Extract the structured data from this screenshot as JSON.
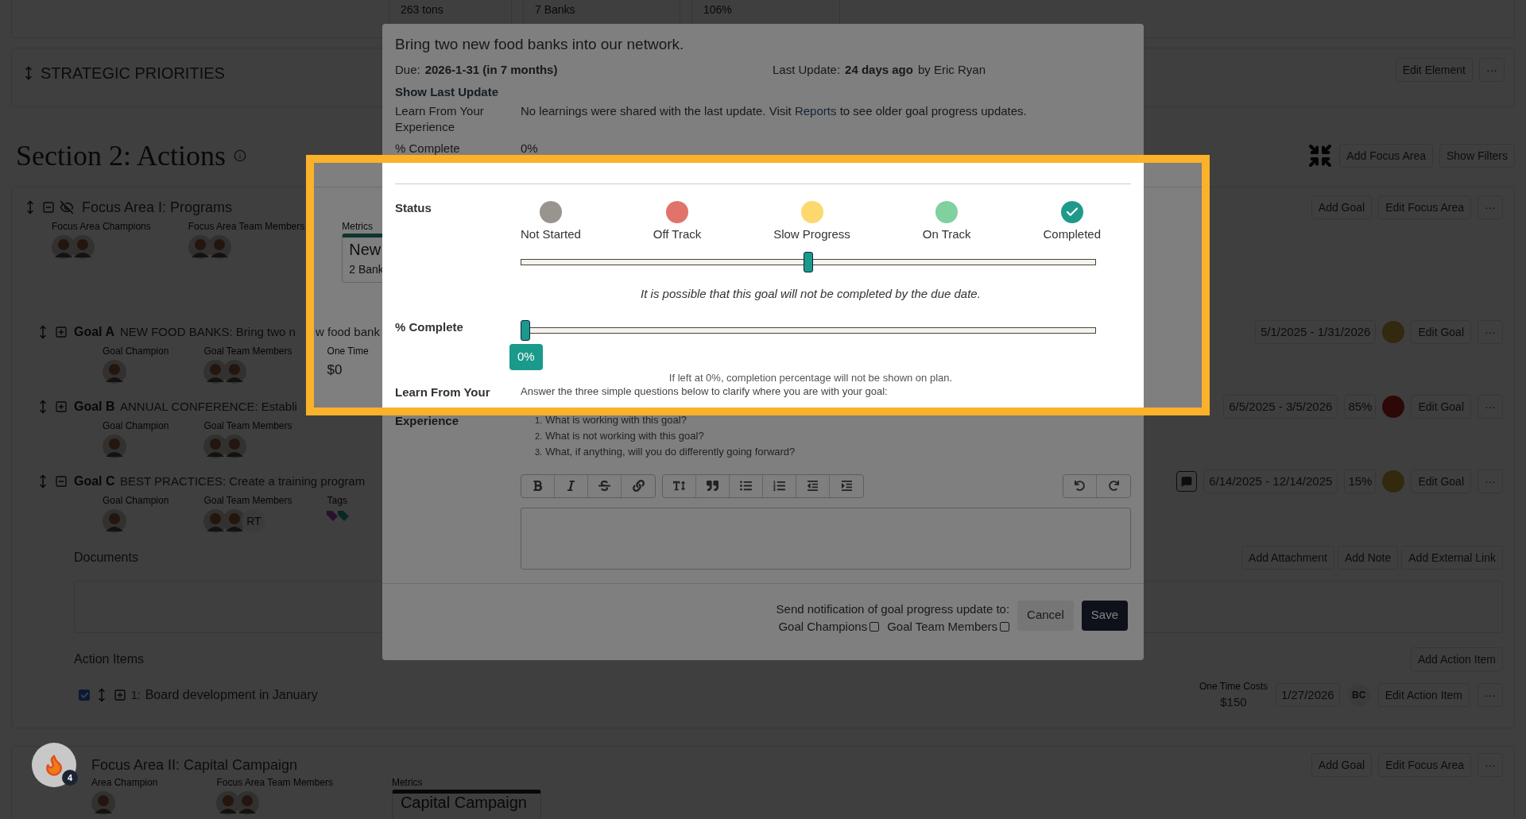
{
  "top_metrics": [
    {
      "value": "263 tons"
    },
    {
      "value": "7 Banks"
    },
    {
      "value": "106%"
    }
  ],
  "strategic_priorities": {
    "title": "STRATEGIC PRIORITIES",
    "buttons": [
      "Edit Element",
      "···"
    ]
  },
  "section": {
    "title": "Section 2: Actions",
    "buttons": [
      "Add Focus Area",
      "Show Filters"
    ]
  },
  "focus_areas": [
    {
      "title": "Focus Area I: Programs",
      "expanded": true,
      "buttons": [
        "Add Goal",
        "Edit Focus Area",
        "···"
      ],
      "people": [
        {
          "label": "Focus Area Champions",
          "avatars": [
            {
              "kind": "picture"
            },
            {
              "kind": "picture"
            }
          ]
        },
        {
          "label": "Focus Area Team Members",
          "avatars": [
            {
              "kind": "picture"
            },
            {
              "kind": "picture"
            }
          ]
        }
      ],
      "metrics": {
        "label": "Metrics",
        "card_title": "New",
        "card_value": "2 Bank",
        "kind": "teal"
      },
      "goals": [
        {
          "label": "Goal A",
          "title": "NEW FOOD BANKS: Bring two n",
          "title_rest": "w food bank",
          "expanded": false,
          "comment": false,
          "dates": "5/1/2025 - 1/31/2026",
          "status_dot": {
            "kind": "slow_progress"
          },
          "buttons": [
            "Edit Goal",
            "···"
          ],
          "fields": [
            {
              "label": "Goal Champion",
              "avatars": [
                {
                  "kind": "picture"
                }
              ]
            },
            {
              "label": "Goal Team Members",
              "avatars": [
                {
                  "kind": "picture"
                },
                {
                  "kind": "picture"
                }
              ]
            },
            {
              "label": "One Time",
              "value": "$0"
            }
          ]
        },
        {
          "label": "Goal B",
          "title": "ANNUAL CONFERENCE: Establi",
          "expanded": false,
          "comment": false,
          "dates": "6/5/2025 - 3/5/2026",
          "percent": "85%",
          "status_dot": {
            "kind": "off_track"
          },
          "buttons": [
            "Edit Goal",
            "···"
          ],
          "fields": [
            {
              "label": "Goal Champion",
              "avatars": [
                {
                  "kind": "picture"
                }
              ]
            },
            {
              "label": "Goal Team Members",
              "avatars": [
                {
                  "kind": "picture"
                },
                {
                  "kind": "picture"
                }
              ]
            }
          ]
        },
        {
          "label": "Goal C",
          "title": "BEST PRACTICES: Create a training program",
          "expanded": true,
          "comment": true,
          "dates": "6/14/2025 - 12/14/2025",
          "percent": "15%",
          "status_dot": {
            "kind": "slow_progress"
          },
          "buttons": [
            "Edit Goal",
            "···"
          ],
          "fields": [
            {
              "label": "Goal Champion",
              "avatars": [
                {
                  "kind": "picture"
                }
              ]
            },
            {
              "label": "Goal Team Members",
              "avatars": [
                {
                  "kind": "picture"
                },
                {
                  "kind": "picture"
                },
                {
                  "kind": "initials",
                  "text": "RT"
                }
              ]
            },
            {
              "label": "Tags",
              "tags": [
                {
                  "kind": "violet"
                },
                {
                  "kind": "teal"
                }
              ]
            }
          ]
        }
      ],
      "documents": {
        "title": "Documents",
        "buttons": [
          "Add Attachment",
          "Add Note",
          "Add External Link"
        ]
      },
      "action_items": {
        "title": "Action Items",
        "button": "Add Action Item",
        "items": [
          {
            "checked": true,
            "number": "1:",
            "title": "Board development in January",
            "cost_label": "One Time Costs",
            "cost": "$150",
            "date": "1/27/2026",
            "assignee": "BC",
            "buttons": [
              "Edit Action Item",
              "···"
            ]
          }
        ]
      }
    },
    {
      "title": "Focus Area II: Capital Campaign",
      "buttons": [
        "Add Goal",
        "Edit Focus Area",
        "···"
      ],
      "people": [
        {
          "label": "Area Champion",
          "avatars": [
            {
              "kind": "picture"
            }
          ]
        },
        {
          "label": "Focus Area Team Members",
          "avatars": [
            {
              "kind": "picture"
            },
            {
              "kind": "picture"
            }
          ]
        }
      ],
      "metrics": {
        "label": "Metrics",
        "card_title": "Capital Campaign",
        "kind": "dark"
      }
    }
  ],
  "floating_button": {
    "badge": "4"
  },
  "modal": {
    "title": "Bring two new food banks into our network.",
    "due_label": "Due:",
    "due": "2026-1-31 (in 7 months)",
    "last_update_label": "Last Update:",
    "last_update": "24 days ago",
    "last_update_by": "by Eric Ryan",
    "show_last_update": "Show Last Update",
    "last_learn_label": "Learn From Your Experience",
    "last_learn_before": "No learnings were shared with the last update. Visit",
    "last_learn_link": "Reports",
    "last_learn_after": "to see older goal progress updates.",
    "last_complete_label": "% Complete",
    "last_complete": "0%",
    "status": {
      "label": "Status",
      "level": 0.5,
      "note": "It is possible that this goal will not be completed by the due date.",
      "options": [
        {
          "label": "Not Started",
          "kind": "dot",
          "color": "#9a948e"
        },
        {
          "label": "Off Track",
          "kind": "dot",
          "color": "#e0736a"
        },
        {
          "label": "Slow Progress",
          "kind": "dot",
          "color": "#fdd86f"
        },
        {
          "label": "On Track",
          "kind": "dot",
          "color": "#80d0a0"
        },
        {
          "label": "Completed",
          "kind": "check",
          "color": "#1f9a8a"
        }
      ]
    },
    "percent": {
      "label": "% Complete",
      "level": 0,
      "value": "0%",
      "note": "If left at 0%, completion percentage will not be shown on plan."
    },
    "learn": {
      "label_top": "Learn From Your",
      "label_bottom": "Experience",
      "intro": "Answer the three simple questions below to clarify where you are with your goal:",
      "questions": [
        {
          "number": "1.",
          "text": "What is working with this goal?"
        },
        {
          "number": "2.",
          "text": "What is not working with this goal?"
        },
        {
          "number": "3.",
          "text": "What, if anything, will you do differently going forward?"
        }
      ]
    },
    "notify": {
      "label": "Send notification of goal progress update to:",
      "recipients": [
        {
          "label": "Goal Champions",
          "checked": false
        },
        {
          "label": "Goal Team Members",
          "checked": false
        }
      ]
    },
    "buttons": [
      {
        "label": "Cancel",
        "kind": "secondary"
      },
      {
        "label": "Save",
        "kind": "primary"
      }
    ]
  }
}
